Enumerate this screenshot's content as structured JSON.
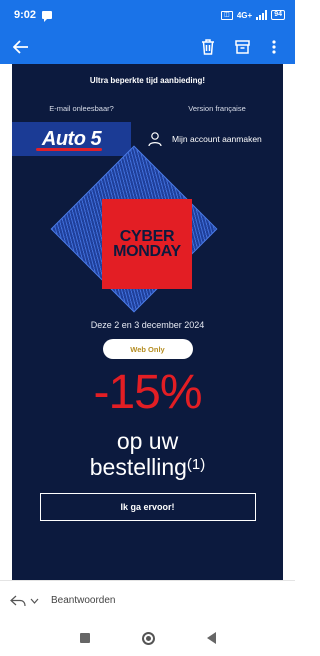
{
  "status_bar": {
    "time": "9:02",
    "network": "4G+",
    "battery": "94"
  },
  "email": {
    "promo_top": "Ultra beperkte tijd aanbieding!",
    "link_unreadable": "E-mail onleesbaar?",
    "link_french": "Version française",
    "logo_text": "Auto 5",
    "account_label": "Mijn account aanmaken",
    "cyber_line1": "CYBER",
    "cyber_line2": "MONDAY",
    "dates": "Deze 2 en 3 december 2024",
    "pill": "Web Only",
    "discount": "-15%",
    "line1": "op uw",
    "line2": "bestelling",
    "footnote": "(1)",
    "cta": "Ik ga ervoor!"
  },
  "reply_bar": {
    "label": "Beantwoorden"
  },
  "colors": {
    "app_blue": "#1a73e8",
    "email_bg": "#0c1a3e",
    "red": "#e31e24",
    "pill_text": "#b58e24"
  }
}
